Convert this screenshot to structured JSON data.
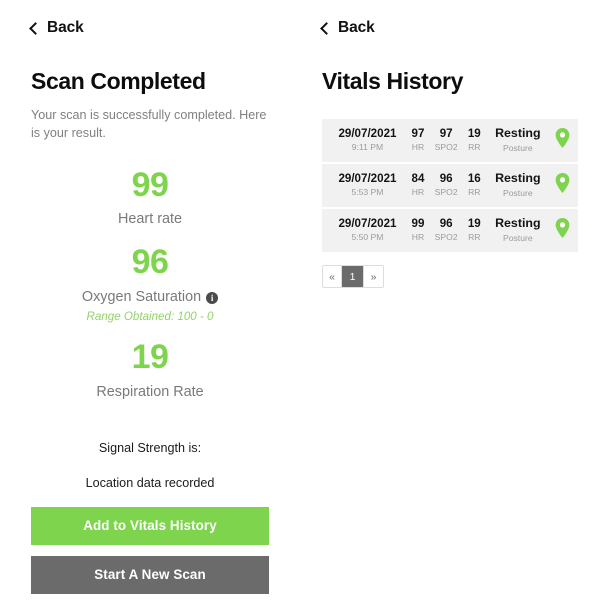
{
  "left": {
    "back": {
      "label": "Back",
      "icon": "chevron-left-icon"
    },
    "title": "Scan Completed",
    "subtitle": "Your scan is successfully completed. Here is your result.",
    "vitals": [
      {
        "value": "99",
        "label": "Heart rate",
        "info": null,
        "range": null
      },
      {
        "value": "96",
        "label": "Oxygen Saturation",
        "info": "i",
        "range": "Range Obtained: 100 - 0"
      },
      {
        "value": "19",
        "label": "Respiration Rate",
        "info": null,
        "range": null
      }
    ],
    "notes": [
      "Signal Strength is:",
      "Location data recorded"
    ],
    "buttons": {
      "primary": "Add to Vitals History",
      "secondary": "Start A New Scan"
    }
  },
  "right": {
    "back": {
      "label": "Back",
      "icon": "chevron-left-icon"
    },
    "title": "Vitals History",
    "table": {
      "sublabels": {
        "hr": "HR",
        "spo2": "SPO2",
        "rr": "RR",
        "posture": "Posture"
      },
      "rows": [
        {
          "date": "29/07/2021",
          "time": "9:11 PM",
          "hr": "97",
          "spo2": "97",
          "rr": "19",
          "posture": "Resting",
          "pin": "location-pin-icon"
        },
        {
          "date": "29/07/2021",
          "time": "5:53 PM",
          "hr": "84",
          "spo2": "96",
          "rr": "16",
          "posture": "Resting",
          "pin": "location-pin-icon"
        },
        {
          "date": "29/07/2021",
          "time": "5:50 PM",
          "hr": "99",
          "spo2": "96",
          "rr": "19",
          "posture": "Resting",
          "pin": "location-pin-icon"
        }
      ]
    },
    "pagination": {
      "prev": "«",
      "pages": [
        "1"
      ],
      "next": "»",
      "current": "1"
    }
  },
  "colors": {
    "accent_green": "#7fd44e",
    "range_green": "#92d36a",
    "button_gray": "#6b6b6b",
    "row_bg": "#f1f1f1",
    "muted_text": "#808080"
  }
}
